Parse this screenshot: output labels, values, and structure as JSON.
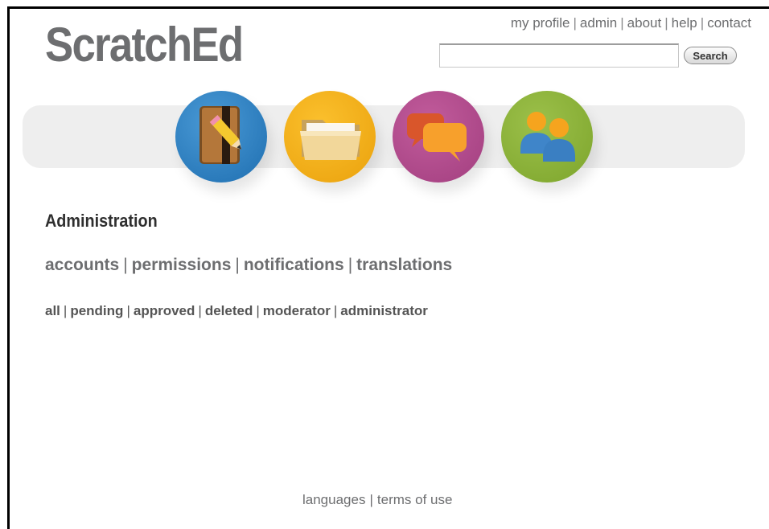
{
  "header": {
    "logo": "ScratchEd",
    "top_links": [
      "my profile",
      "admin",
      "about",
      "help",
      "contact"
    ],
    "search": {
      "value": "",
      "placeholder": "",
      "button_label": "Search"
    }
  },
  "nav_icons": [
    {
      "name": "resources",
      "icon": "notebook-pencil-icon",
      "color": "#2b7dc1"
    },
    {
      "name": "stories",
      "icon": "folder-icon",
      "color": "#f5b01f"
    },
    {
      "name": "discussions",
      "icon": "speech-bubbles-icon",
      "color": "#b24b8d"
    },
    {
      "name": "members",
      "icon": "people-icon",
      "color": "#8db53b"
    }
  ],
  "main": {
    "title": "Administration",
    "tabs": [
      "accounts",
      "permissions",
      "notifications",
      "translations"
    ],
    "filters": [
      "all",
      "pending",
      "approved",
      "deleted",
      "moderator",
      "administrator"
    ]
  },
  "footer": {
    "links": [
      "languages",
      "terms of use"
    ]
  },
  "colors": {
    "logo_gray": "#6d6e70",
    "navbar_bg": "#eeeeee"
  }
}
